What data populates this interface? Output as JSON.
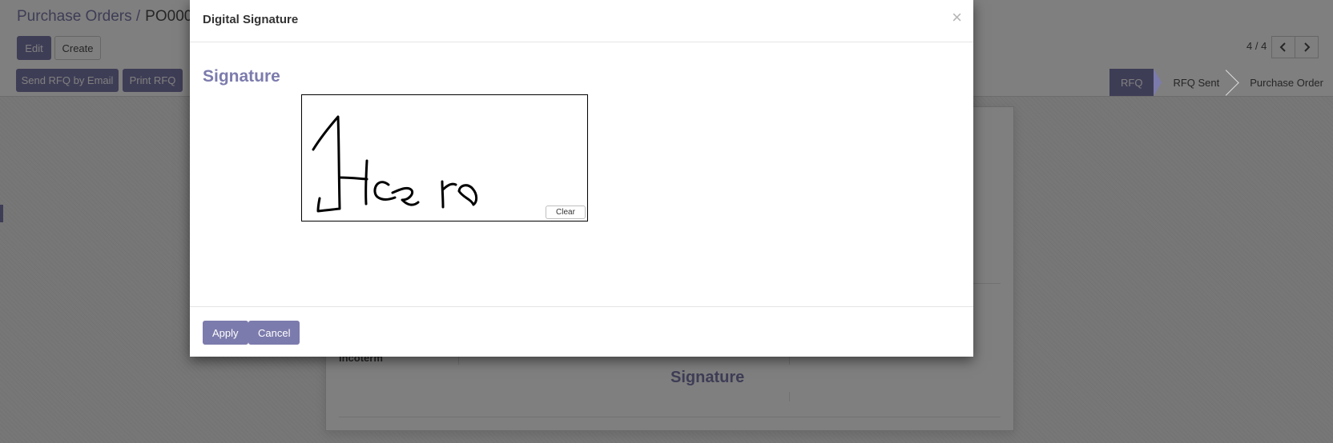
{
  "page": {
    "breadcrumb": {
      "parent": "Purchase Orders /",
      "current": "PO0001"
    },
    "toolbar": {
      "edit_label": "Edit",
      "create_label": "Create"
    },
    "pager": {
      "value": "4 / 4",
      "prev_icon": "chevron-left-icon",
      "next_icon": "chevron-right-icon"
    },
    "actions": {
      "send_rfq_label": "Send RFQ by Email",
      "print_rfq_label": "Print RFQ"
    },
    "status_steps": [
      "RFQ",
      "RFQ Sent",
      "Purchase Order"
    ],
    "active_status": "RFQ",
    "sheet": {
      "incoterm_label": "Incoterm",
      "signature_title": "Signature"
    }
  },
  "modal": {
    "title": "Digital Signature",
    "close_icon": "close-icon",
    "signature_label": "Signature",
    "clear_label": "Clear",
    "apply_label": "Apply",
    "cancel_label": "Cancel"
  },
  "colors": {
    "accent": "#7c7bad",
    "overlay": "rgba(0,0,0,0.5)"
  }
}
